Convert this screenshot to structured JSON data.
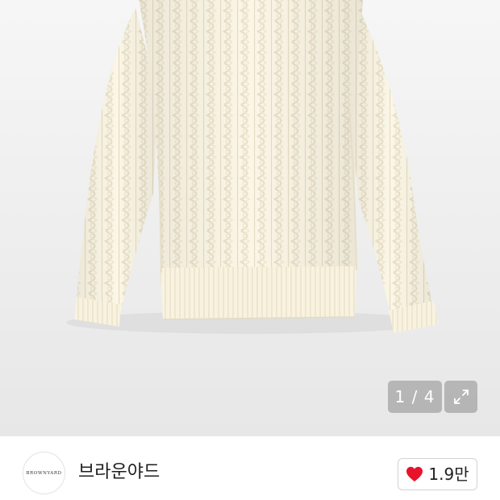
{
  "product_image": {
    "alt": "cream cable-knit sweater",
    "background": "#ededed",
    "garment_color": "#fbf6e6",
    "counter": {
      "current": "1",
      "separator": " / ",
      "total": "4"
    },
    "expand_icon": "expand-arrows-icon"
  },
  "seller": {
    "logo_text": "BROWNYARD",
    "name": "브라운야드"
  },
  "like": {
    "icon": "heart-icon",
    "icon_color": "#e8132b",
    "count": "1.9만"
  }
}
